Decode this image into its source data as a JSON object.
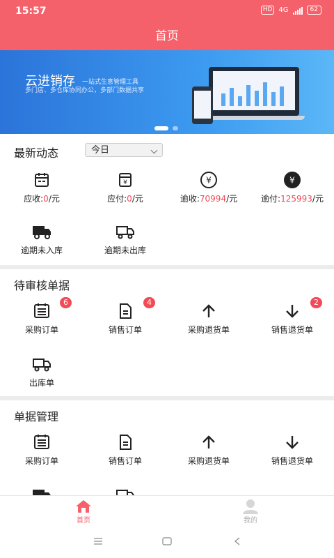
{
  "status": {
    "time": "15:57",
    "hd": "HD",
    "network": "4G",
    "battery": "62"
  },
  "header": {
    "title": "首页"
  },
  "banner": {
    "brand": "云进销存",
    "tagline": "一站式生意管理工具",
    "subtitle": "多门店、多仓库协同办公，多部门数据共享"
  },
  "latest": {
    "title": "最新动态",
    "filter_value": "今日",
    "stats": [
      {
        "label": "应收:",
        "value": "0",
        "unit": "/元",
        "icon": "calendar-icon"
      },
      {
        "label": "应付:",
        "value": "0",
        "unit": "/元",
        "icon": "cabinet-yen-icon"
      },
      {
        "label": "逾收:",
        "value": "70994",
        "unit": "/元",
        "icon": "yen-circle-outline-icon"
      },
      {
        "label": "逾付:",
        "value": "125993",
        "unit": "/元",
        "icon": "yen-circle-filled-icon"
      }
    ],
    "items": [
      {
        "label": "逾期未入库",
        "icon": "truck-filled-icon"
      },
      {
        "label": "逾期未出库",
        "icon": "truck-outline-icon"
      }
    ]
  },
  "pending": {
    "title": "待审核单据",
    "items": [
      {
        "label": "采购订单",
        "badge": "6",
        "icon": "list-doc-icon"
      },
      {
        "label": "销售订单",
        "badge": "4",
        "icon": "doc-icon"
      },
      {
        "label": "采购退货单",
        "badge": "",
        "icon": "arrow-up-icon"
      },
      {
        "label": "销售退货单",
        "badge": "2",
        "icon": "arrow-down-icon"
      },
      {
        "label": "出库单",
        "badge": "",
        "icon": "truck-outline-icon"
      }
    ]
  },
  "docs": {
    "title": "单据管理",
    "items": [
      {
        "label": "采购订单",
        "icon": "list-doc-icon"
      },
      {
        "label": "销售订单",
        "icon": "doc-icon"
      },
      {
        "label": "采购退货单",
        "icon": "arrow-up-icon"
      },
      {
        "label": "销售退货单",
        "icon": "arrow-down-icon"
      }
    ]
  },
  "tabs": [
    {
      "label": "首页",
      "active": true,
      "icon": "home-icon"
    },
    {
      "label": "我的",
      "active": false,
      "icon": "user-icon"
    }
  ],
  "colors": {
    "primary": "#f4616b",
    "accent": "#f04b57"
  }
}
